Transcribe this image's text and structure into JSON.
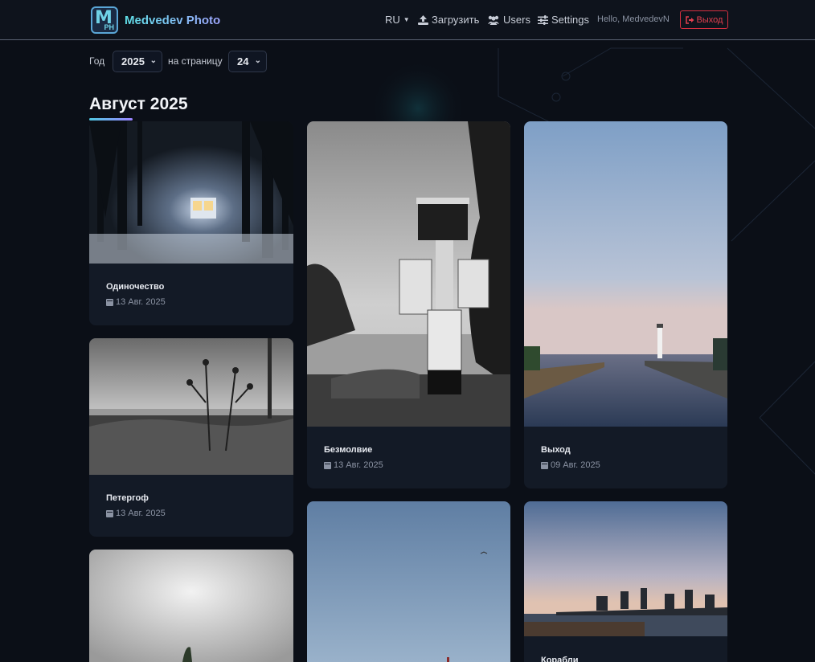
{
  "brand": {
    "logo_m": "M",
    "logo_ph": "PH",
    "name": "Medvedev Photo"
  },
  "nav": {
    "language": "RU",
    "upload": "Загрузить",
    "users": "Users",
    "settings": "Settings",
    "hello": "Hello, MedvedevN",
    "logout": "Выход"
  },
  "filters": {
    "year_label": "Год",
    "year_value": "2025",
    "per_page_label": "на страницу",
    "per_page_value": "24"
  },
  "section": {
    "title": "Август 2025"
  },
  "cards": [
    {
      "title": "Одиночество",
      "date": "13 Авг. 2025"
    },
    {
      "title": "Петергоф",
      "date": "13 Авг. 2025"
    },
    {
      "title": "Безмолвие",
      "date": "13 Авг. 2025"
    },
    {
      "title": "Выход",
      "date": "09 Авг. 2025"
    },
    {
      "title": "Корабли",
      "date": ""
    }
  ],
  "icons": {
    "upload": "upload-icon",
    "users": "users-icon",
    "settings": "sliders-icon",
    "logout": "sign-out-icon",
    "calendar": "calendar-icon"
  },
  "colors": {
    "accent": "#5fe0e8",
    "danger": "#e3404f",
    "background": "#0b0f17",
    "card": "#131a26"
  }
}
